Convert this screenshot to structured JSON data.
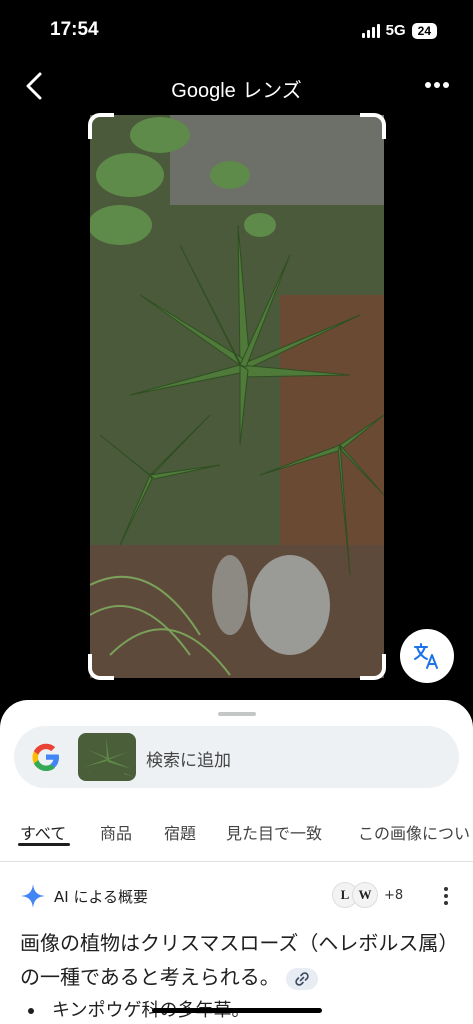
{
  "status": {
    "time": "17:54",
    "network": "5G",
    "battery": "24"
  },
  "header": {
    "title_brand": "Google",
    "title_suffix": "レンズ",
    "back_icon": "chevron-left-icon",
    "menu_icon": "more-horiz-icon"
  },
  "search": {
    "add_label": "検索に追加",
    "logo_icon": "google-g-icon"
  },
  "tabs": [
    "すべて",
    "商品",
    "宿題",
    "見た目で一致",
    "この画像につい"
  ],
  "ai_overview": {
    "label": "AI による概要",
    "sources": [
      "L",
      "W",
      "+8"
    ],
    "summary": "画像の植物はクリスマスローズ（ヘレボルス属）の一種であると考えられる。",
    "bullets": [
      "キンポウゲ科の多年草。"
    ]
  },
  "colors": {
    "accent_blue": "#4285F4",
    "sheet_bg": "#ffffff",
    "search_bg": "#eef1f3"
  }
}
